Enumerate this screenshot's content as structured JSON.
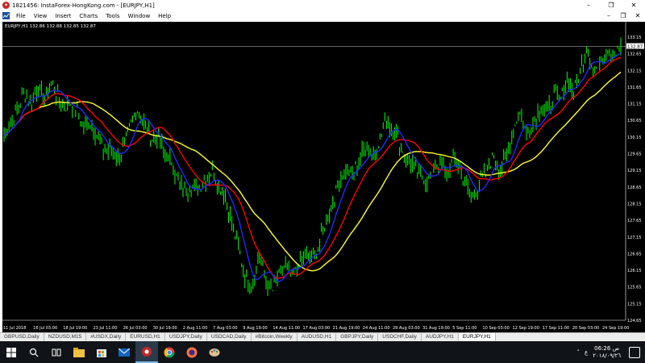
{
  "window": {
    "title": "1821456: InstaForex-HongKong.com - [EURJPY,H1]",
    "controls": [
      "–",
      "❐",
      "✕"
    ]
  },
  "menu": {
    "items": [
      "File",
      "View",
      "Insert",
      "Charts",
      "Tools",
      "Window",
      "Help"
    ],
    "child_controls": [
      "–",
      "❐",
      "✕"
    ]
  },
  "chart": {
    "info": "EURJPY,H1  132.86 132.88 132.85 132.87",
    "current_price": "132.87",
    "colors": {
      "background": "#000000",
      "candles": "#00ff00",
      "ma_fast": "#1e2cff",
      "ma_mid": "#ff0000",
      "ma_slow": "#ffff33",
      "grid_text": "#ffffff",
      "price_line": "#a0a0a0"
    }
  },
  "chart_data": {
    "type": "line",
    "symbol": "EURJPY",
    "timeframe": "H1",
    "ylim": [
      124.65,
      133.15
    ],
    "y_ticks": [
      "133.15",
      "132.65",
      "132.15",
      "131.65",
      "131.15",
      "130.65",
      "130.15",
      "129.65",
      "129.15",
      "128.65",
      "128.15",
      "127.65",
      "127.15",
      "126.65",
      "126.15",
      "125.65",
      "125.15",
      "124.65"
    ],
    "x_ticks": [
      "11 Jul 2018",
      "16 Jul 03:00",
      "18 Jul 19:00",
      "23 Jul 11:00",
      "26 Jul 03:00",
      "30 Jul 19:00",
      "2 Aug 11:00",
      "7 Aug 03:00",
      "9 Aug 19:00",
      "14 Aug 11:00",
      "17 Aug 03:00",
      "21 Aug 19:00",
      "24 Aug 11:00",
      "29 Aug 03:00",
      "31 Aug 19:00",
      "5 Sep 11:00",
      "10 Sep 03:00",
      "12 Sep 19:00",
      "17 Sep 11:00",
      "20 Sep 03:00",
      "24 Sep 19:00"
    ],
    "price_keyframes": [
      [
        0,
        130.2
      ],
      [
        2,
        130.6
      ],
      [
        4,
        131.0
      ],
      [
        6,
        131.5
      ],
      [
        8,
        131.2
      ],
      [
        10,
        131.6
      ],
      [
        12,
        131.3
      ],
      [
        14,
        131.8
      ],
      [
        16,
        131.4
      ],
      [
        18,
        131.0
      ],
      [
        20,
        131.2
      ],
      [
        22,
        130.9
      ],
      [
        24,
        130.4
      ],
      [
        26,
        130.6
      ],
      [
        28,
        130.1
      ],
      [
        30,
        129.7
      ],
      [
        32,
        129.8
      ],
      [
        34,
        129.5
      ],
      [
        36,
        129.9
      ],
      [
        38,
        130.6
      ],
      [
        40,
        131.0
      ],
      [
        42,
        130.5
      ],
      [
        44,
        130.1
      ],
      [
        46,
        130.2
      ],
      [
        48,
        129.6
      ],
      [
        50,
        129.4
      ],
      [
        52,
        128.8
      ],
      [
        54,
        128.5
      ],
      [
        56,
        128.7
      ],
      [
        58,
        128.6
      ],
      [
        60,
        128.9
      ],
      [
        62,
        129.1
      ],
      [
        64,
        128.7
      ],
      [
        66,
        128.4
      ],
      [
        68,
        127.6
      ],
      [
        70,
        126.8
      ],
      [
        72,
        125.9
      ],
      [
        74,
        125.6
      ],
      [
        76,
        126.6
      ],
      [
        78,
        125.9
      ],
      [
        80,
        125.5
      ],
      [
        82,
        126.0
      ],
      [
        84,
        126.3
      ],
      [
        86,
        125.9
      ],
      [
        88,
        126.4
      ],
      [
        90,
        126.6
      ],
      [
        92,
        126.5
      ],
      [
        94,
        126.9
      ],
      [
        96,
        127.6
      ],
      [
        98,
        128.2
      ],
      [
        100,
        128.8
      ],
      [
        102,
        129.2
      ],
      [
        104,
        129.0
      ],
      [
        106,
        129.5
      ],
      [
        108,
        129.9
      ],
      [
        110,
        129.6
      ],
      [
        112,
        130.1
      ],
      [
        114,
        130.6
      ],
      [
        116,
        130.4
      ],
      [
        118,
        130.0
      ],
      [
        120,
        129.5
      ],
      [
        122,
        129.3
      ],
      [
        124,
        129.0
      ],
      [
        126,
        128.8
      ],
      [
        128,
        129.2
      ],
      [
        130,
        129.4
      ],
      [
        132,
        129.0
      ],
      [
        134,
        129.5
      ],
      [
        136,
        129.2
      ],
      [
        138,
        128.6
      ],
      [
        140,
        128.3
      ],
      [
        142,
        128.8
      ],
      [
        144,
        129.1
      ],
      [
        146,
        129.6
      ],
      [
        148,
        129.2
      ],
      [
        150,
        129.5
      ],
      [
        152,
        130.4
      ],
      [
        154,
        130.9
      ],
      [
        156,
        130.2
      ],
      [
        158,
        130.6
      ],
      [
        160,
        131.0
      ],
      [
        162,
        130.9
      ],
      [
        164,
        131.4
      ],
      [
        166,
        131.3
      ],
      [
        168,
        131.9
      ],
      [
        170,
        131.5
      ],
      [
        172,
        132.2
      ],
      [
        174,
        132.9
      ],
      [
        176,
        132.1
      ],
      [
        178,
        132.5
      ],
      [
        180,
        132.8
      ],
      [
        182,
        132.6
      ],
      [
        184,
        132.87
      ]
    ]
  },
  "tabs": [
    "GBPUSD,Daily",
    "NZDUSD,M15",
    "#USDX,Daily",
    "EURUSD,H1",
    "USDJPY,Daily",
    "USDCAD,Daily",
    "#Bitcoin,Weekly",
    "AUDUSD,H1",
    "GBPJPY,Daily",
    "USDCHF,Daily",
    "AUDJPY,H1",
    "EURJPY,H1"
  ],
  "active_tab": "EURJPY,H1",
  "taskbar": {
    "icons": [
      "windows-icon",
      "search-icon",
      "task-view-icon",
      "file-explorer-icon",
      "store-icon",
      "mail-icon",
      "terminal-app-icon",
      "chrome-icon",
      "firefox-icon",
      "paint-icon"
    ],
    "lang": "ع",
    "time": "06:26 ص",
    "date": "٢٠١٨/٠٩/٢٦"
  }
}
